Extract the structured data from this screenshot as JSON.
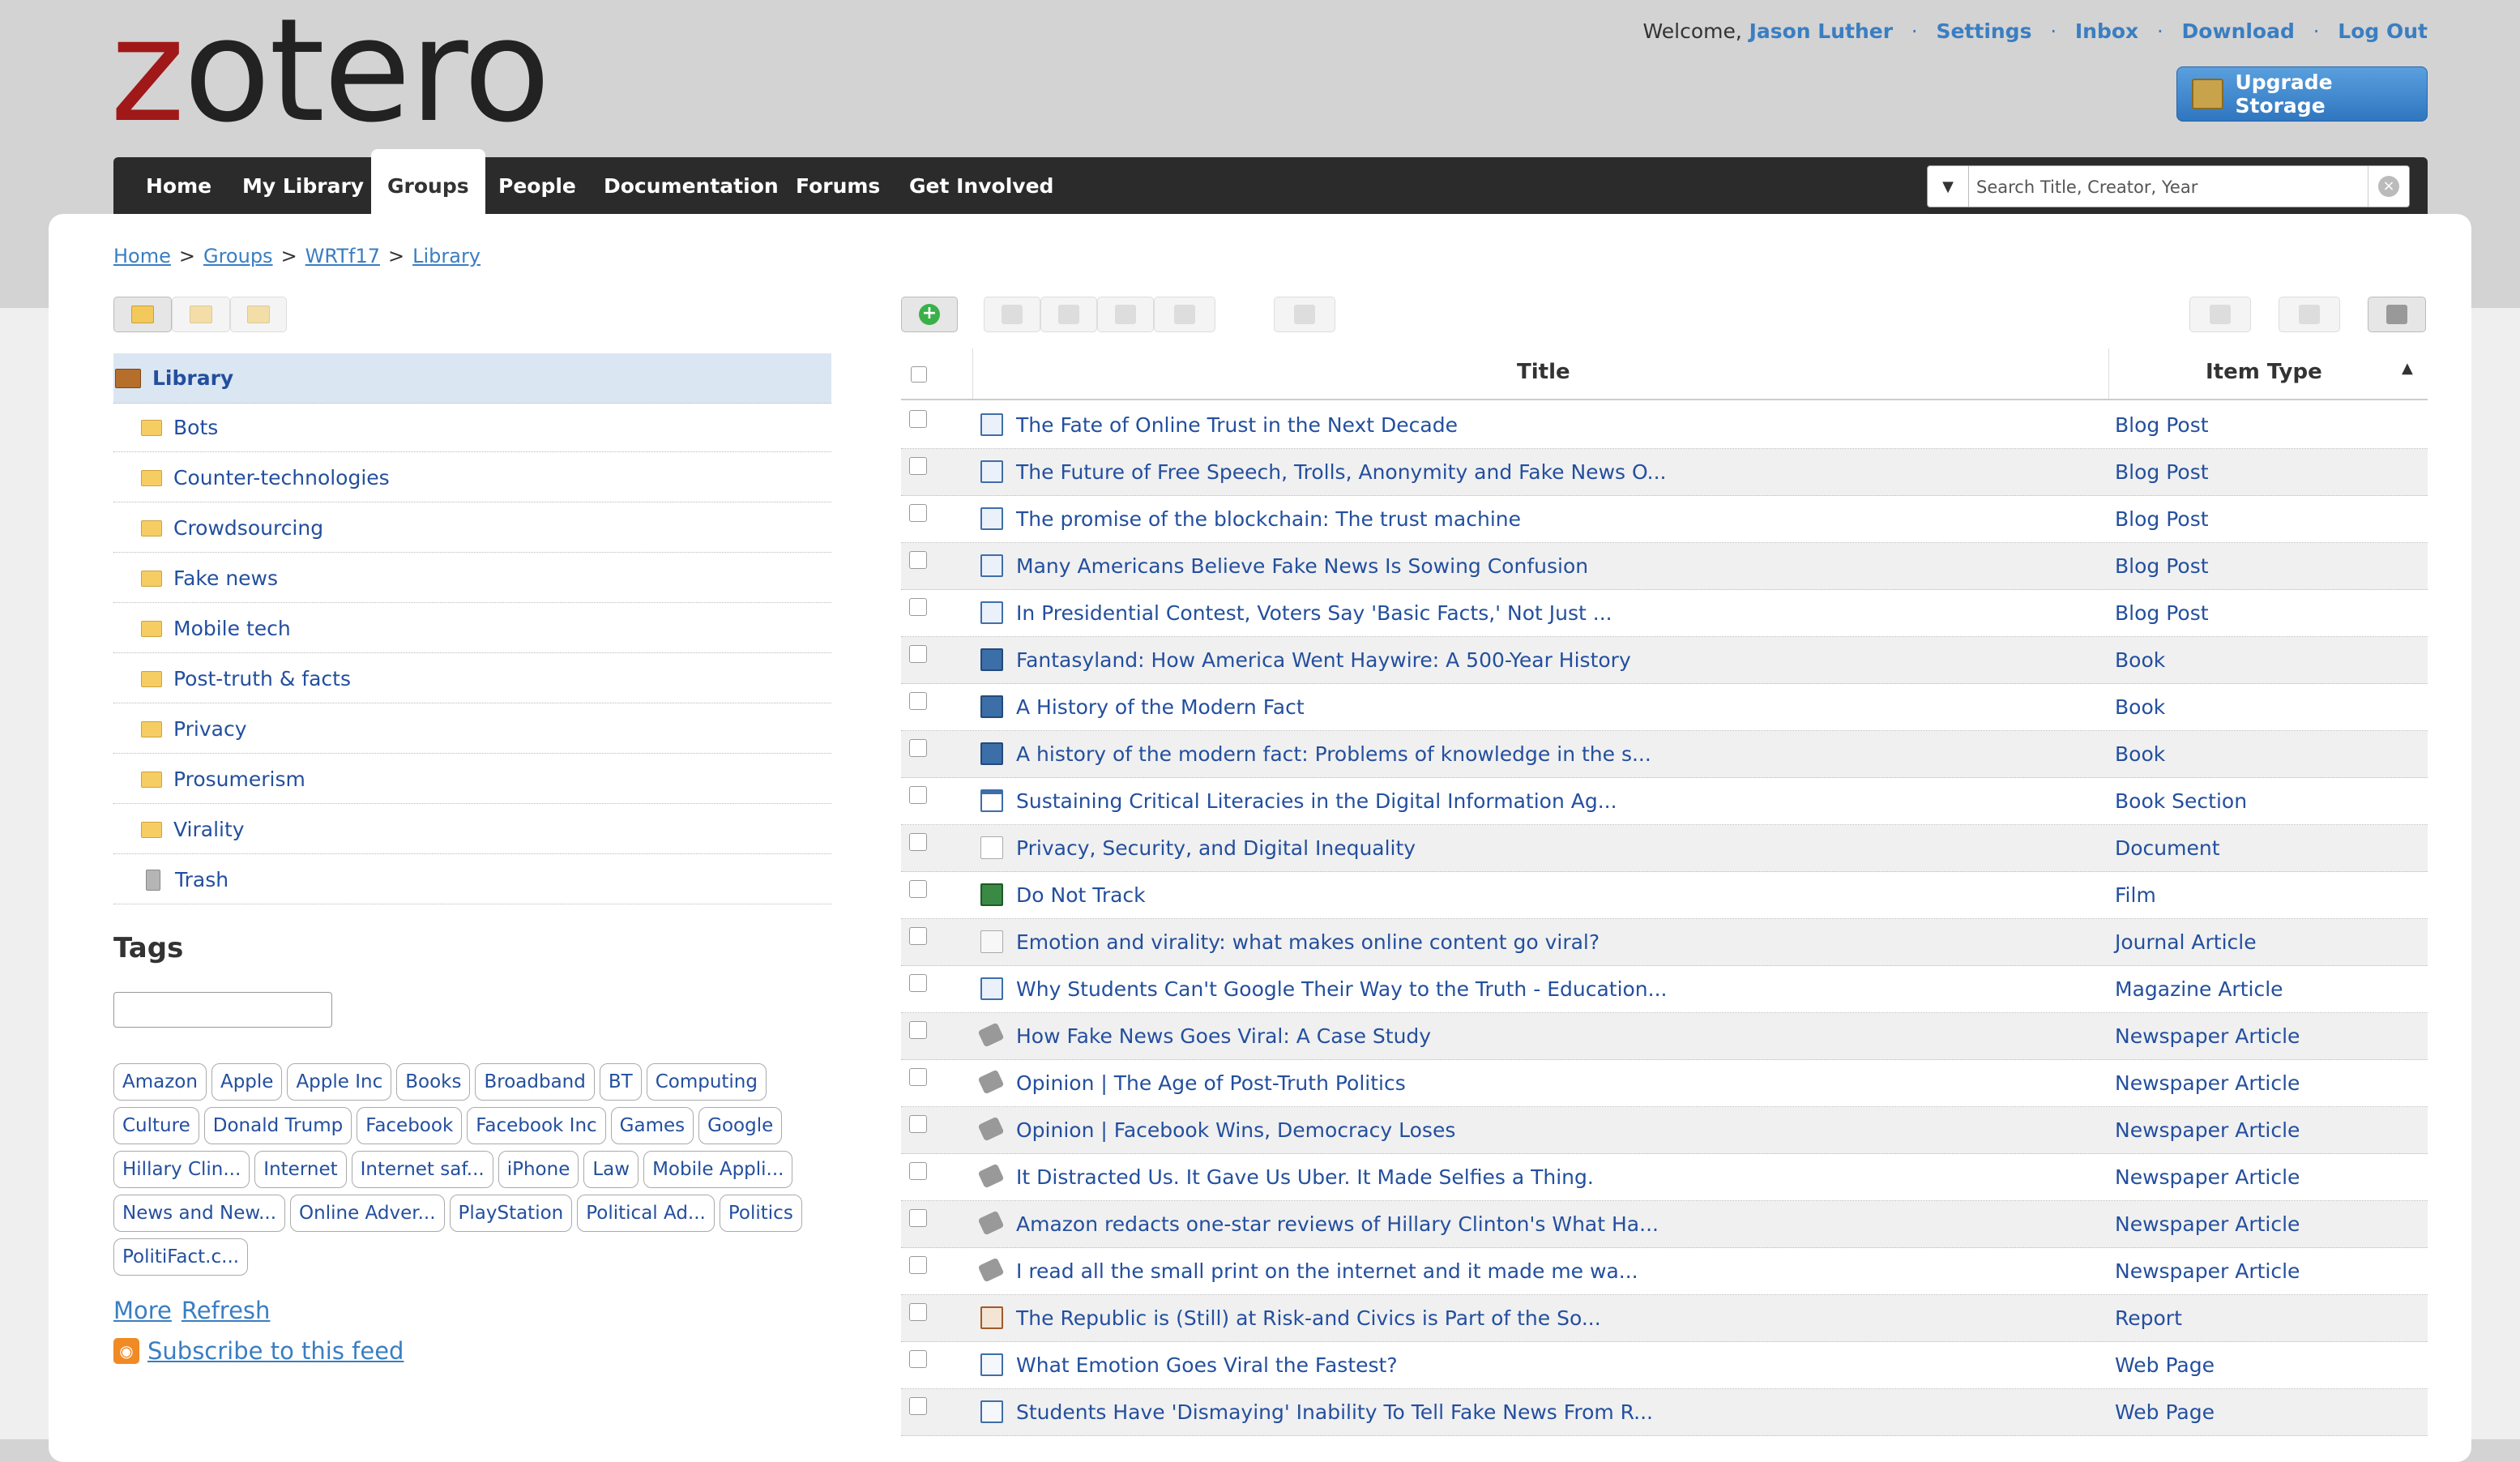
{
  "logo_text": "zotero",
  "userbar": {
    "welcome": "Welcome,",
    "user": "Jason Luther",
    "links": [
      "Settings",
      "Inbox",
      "Download",
      "Log Out"
    ]
  },
  "upgrade_label": "Upgrade Storage",
  "nav": [
    "Home",
    "My Library",
    "Groups",
    "People",
    "Documentation",
    "Forums",
    "Get Involved"
  ],
  "nav_active": "Groups",
  "search": {
    "placeholder": "Search Title, Creator, Year"
  },
  "breadcrumb": [
    "Home",
    "Groups",
    "WRTf17",
    "Library"
  ],
  "collections": {
    "root": "Library",
    "items": [
      "Bots",
      "Counter-technologies",
      "Crowdsourcing",
      "Fake news",
      "Mobile tech",
      "Post-truth & facts",
      "Privacy",
      "Prosumerism",
      "Virality"
    ],
    "trash": "Trash"
  },
  "tags": {
    "title": "Tags",
    "rows": [
      [
        "Amazon",
        "Apple",
        "Apple Inc",
        "Books",
        "Broadband",
        "BT",
        "Computing"
      ],
      [
        "Culture",
        "Donald Trump",
        "Facebook",
        "Facebook Inc",
        "Games",
        "Google"
      ],
      [
        "Hillary Clin...",
        "Internet",
        "Internet saf...",
        "iPhone",
        "Law",
        "Mobile Appli..."
      ],
      [
        "News and New...",
        "Online Adver...",
        "PlayStation",
        "Political Ad...",
        "Politics"
      ],
      [
        "PolitiFact.c..."
      ]
    ],
    "more": "More",
    "refresh": "Refresh",
    "subscribe": "Subscribe to this feed"
  },
  "table": {
    "col_title": "Title",
    "col_type": "Item Type",
    "rows": [
      {
        "title": "The Fate of Online Trust in the Next Decade",
        "type": "Blog Post",
        "icon": "blog"
      },
      {
        "title": "The Future of Free Speech, Trolls, Anonymity and Fake News O...",
        "type": "Blog Post",
        "icon": "blog"
      },
      {
        "title": "The promise of the blockchain: The trust machine",
        "type": "Blog Post",
        "icon": "blog"
      },
      {
        "title": "Many Americans Believe Fake News Is Sowing Confusion",
        "type": "Blog Post",
        "icon": "blog"
      },
      {
        "title": "In Presidential Contest, Voters Say 'Basic Facts,' Not Just ...",
        "type": "Blog Post",
        "icon": "blog"
      },
      {
        "title": "Fantasyland: How America Went Haywire: A 500-Year History",
        "type": "Book",
        "icon": "book"
      },
      {
        "title": "A History of the Modern Fact",
        "type": "Book",
        "icon": "book"
      },
      {
        "title": "A history of the modern fact: Problems of knowledge in the s...",
        "type": "Book",
        "icon": "book"
      },
      {
        "title": "Sustaining Critical Literacies in the Digital Information Ag...",
        "type": "Book Section",
        "icon": "section"
      },
      {
        "title": "Privacy, Security, and Digital Inequality",
        "type": "Document",
        "icon": "doc"
      },
      {
        "title": "Do Not Track",
        "type": "Film",
        "icon": "film"
      },
      {
        "title": "Emotion and virality: what makes online content go viral?",
        "type": "Journal Article",
        "icon": "journal"
      },
      {
        "title": "Why Students Can't Google Their Way to the Truth - Education...",
        "type": "Magazine Article",
        "icon": "mag"
      },
      {
        "title": "How Fake News Goes Viral: A Case Study",
        "type": "Newspaper Article",
        "icon": "news"
      },
      {
        "title": "Opinion | The Age of Post-Truth Politics",
        "type": "Newspaper Article",
        "icon": "news"
      },
      {
        "title": "Opinion | Facebook Wins, Democracy Loses",
        "type": "Newspaper Article",
        "icon": "news"
      },
      {
        "title": "It Distracted Us. It Gave Us Uber. It Made Selfies a Thing.",
        "type": "Newspaper Article",
        "icon": "news"
      },
      {
        "title": "Amazon redacts one-star reviews of Hillary Clinton's What Ha...",
        "type": "Newspaper Article",
        "icon": "news"
      },
      {
        "title": "I read all the small print on the internet and it made me wa...",
        "type": "Newspaper Article",
        "icon": "news"
      },
      {
        "title": "The Republic is (Still) at Risk-and Civics is Part of the So...",
        "type": "Report",
        "icon": "report"
      },
      {
        "title": "What Emotion Goes Viral the Fastest?",
        "type": "Web Page",
        "icon": "web"
      },
      {
        "title": "Students Have 'Dismaying' Inability To Tell Fake News From R...",
        "type": "Web Page",
        "icon": "web"
      }
    ]
  },
  "colors": {
    "link": "#3a7ec2",
    "nav_bg": "#2b2b2b",
    "logo_accent": "#a01818",
    "selected_row": "#dbe6f3"
  }
}
